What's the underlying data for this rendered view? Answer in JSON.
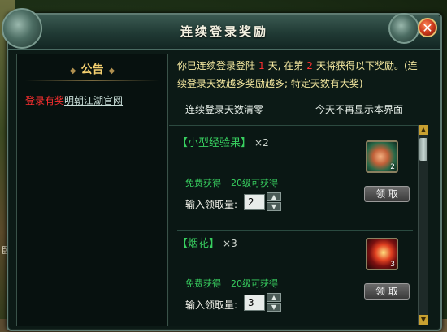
{
  "background": {
    "side_char": "卧"
  },
  "dialog": {
    "title": "连续登录奖励",
    "close_symbol": "✕"
  },
  "notice": {
    "heading": "公告",
    "deco": "◆",
    "tag": "登录有奖",
    "link": "明朝江湖官网"
  },
  "intro": {
    "part1": "你已连续登录登陆",
    "days": "1",
    "part2": "天, 在第",
    "next_day": "2",
    "part3": "天将获得以下奖励。(连续登录天数越多奖励越多; 特定天数有大奖)"
  },
  "links": {
    "reset_notice": "连续登录天数清零",
    "hide_today": "今天不再显示本界面"
  },
  "rewards": [
    {
      "name": "【小型经验果】",
      "multiplier": "×2",
      "free": "免费获得",
      "level_req": "20级可获得",
      "qty_label": "输入领取量:",
      "qty_value": "2",
      "icon_count": "2",
      "claim_label": "领 取",
      "icon": "peach-fruit-icon"
    },
    {
      "name": "【烟花】",
      "multiplier": "×3",
      "free": "免费获得",
      "level_req": "20级可获得",
      "qty_label": "输入领取量:",
      "qty_value": "3",
      "icon_count": "3",
      "claim_label": "领 取",
      "icon": "firework-icon"
    }
  ],
  "scroll": {
    "up": "▲",
    "down": "▼"
  },
  "stepper": {
    "up": "▲",
    "down": "▼"
  },
  "colors": {
    "title_text": "#f2f0e0",
    "accent_red": "#ff3030",
    "reward_green": "#38d060",
    "intro_yellow": "#f4e8a0"
  }
}
